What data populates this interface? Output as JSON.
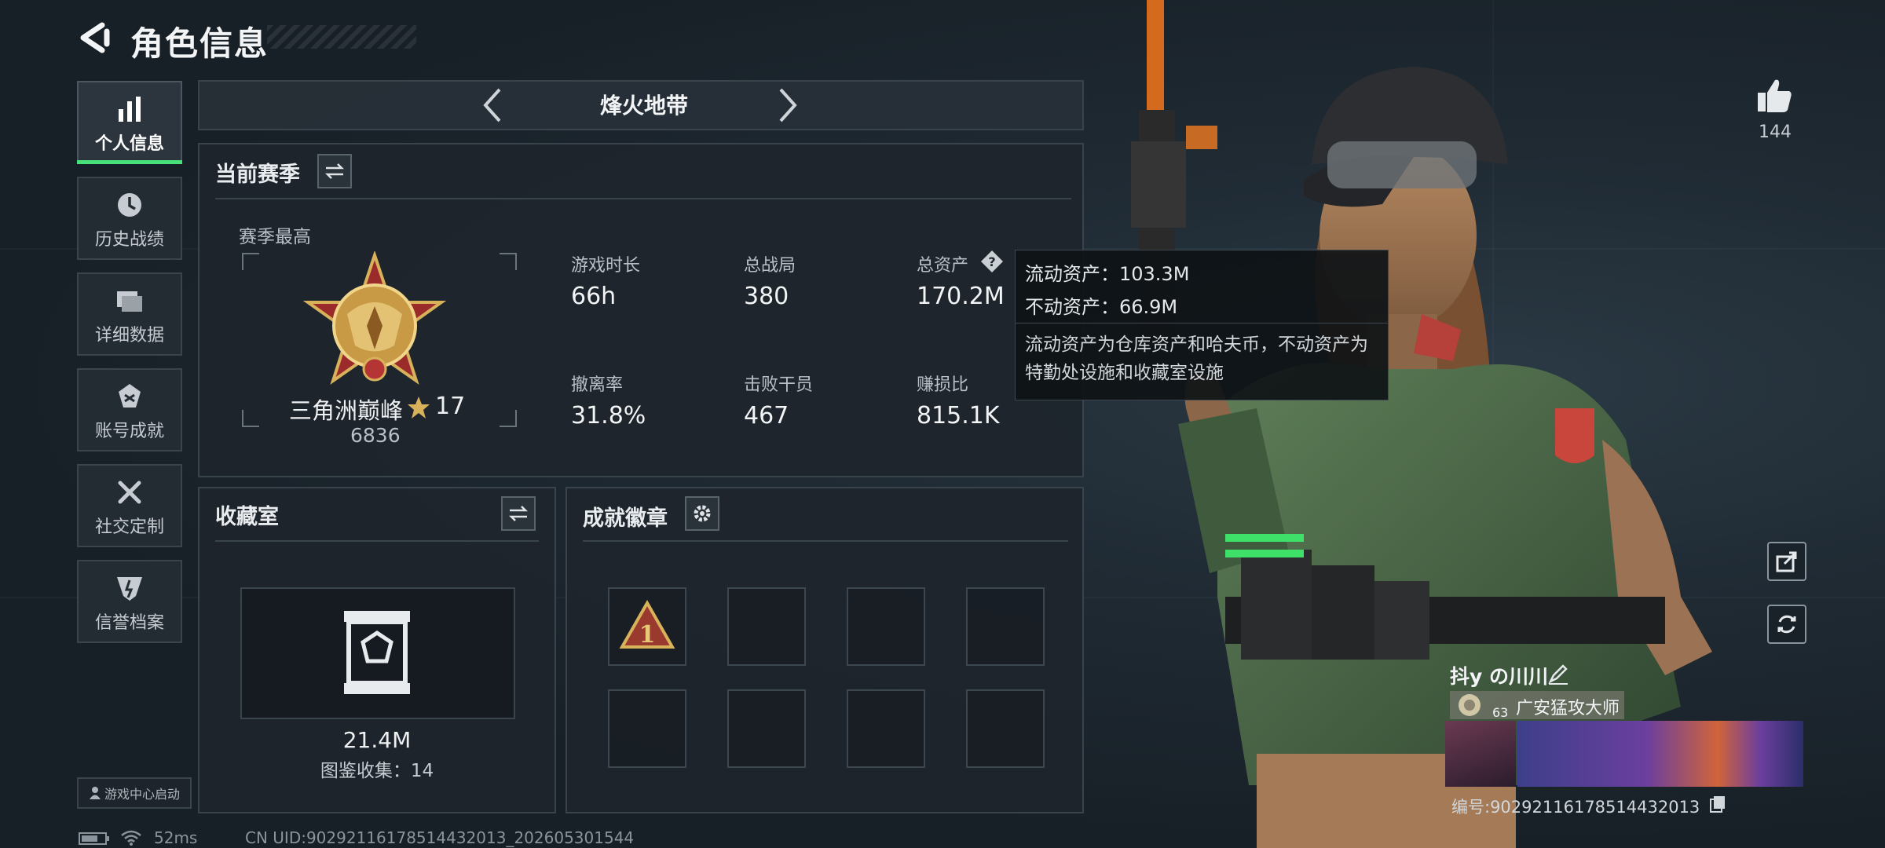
{
  "header": {
    "title": "角色信息"
  },
  "nav": [
    {
      "label": "个人信息",
      "icon": "bar-chart-icon",
      "active": true
    },
    {
      "label": "历史战绩",
      "icon": "clock-icon",
      "active": false
    },
    {
      "label": "详细数据",
      "icon": "folder-icon",
      "active": false
    },
    {
      "label": "账号成就",
      "icon": "medal-icon",
      "active": false
    },
    {
      "label": "社交定制",
      "icon": "wrench-icon",
      "active": false
    },
    {
      "label": "信誉档案",
      "icon": "shield-icon",
      "active": false
    }
  ],
  "mode_selector": {
    "label": "烽火地带"
  },
  "season": {
    "title": "当前赛季",
    "subtitle": "赛季最高",
    "rank_name": "三角洲巅峰",
    "rank_stars": "17",
    "rank_score": "6836",
    "stats": [
      {
        "label": "游戏时长",
        "value": "66h"
      },
      {
        "label": "总战局",
        "value": "380"
      },
      {
        "label": "总资产",
        "value": "170.2M"
      },
      {
        "label": "撤离率",
        "value": "31.8%"
      },
      {
        "label": "击败干员",
        "value": "467"
      },
      {
        "label": "赚损比",
        "value": "815.1K"
      }
    ]
  },
  "tooltip": {
    "liquid": "流动资产：103.3M",
    "fixed": "不动资产：66.9M",
    "desc": "流动资产为仓库资产和哈夫币，不动资产为特勤处设施和收藏室设施"
  },
  "collection": {
    "title": "收藏室",
    "value": "21.4M",
    "count_text": "图鉴收集：14"
  },
  "achievements": {
    "title": "成就徽章",
    "first_badge": "1"
  },
  "right": {
    "likes": "144",
    "player_name": "抖y の川川",
    "player_title": "广安猛攻大师",
    "level": "63",
    "player_id": "编号:902921161785144320​13"
  },
  "footer": {
    "launch": "游戏中心启动",
    "ping": "52ms",
    "uid": "CN UID:9029211617851443201​3_202605301544"
  },
  "colors": {
    "accent_green": "#48e07a",
    "gold": "#d8b25a",
    "panel": "#1e252c"
  }
}
